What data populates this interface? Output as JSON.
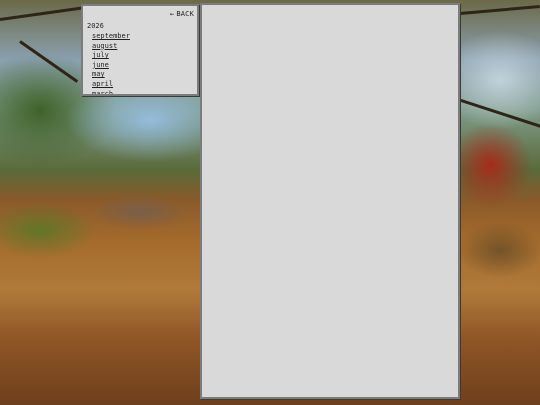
{
  "nav": {
    "back_icon": "arrow-left-icon",
    "back_label": "BACK"
  },
  "archive": {
    "year": "2026",
    "months": [
      "september",
      "august",
      "july",
      "june",
      "may",
      "april",
      "march"
    ]
  },
  "colors": {
    "panel_background": "#d9d9d9",
    "panel_border": "#7c7c7c",
    "text": "#1f1f1f"
  }
}
